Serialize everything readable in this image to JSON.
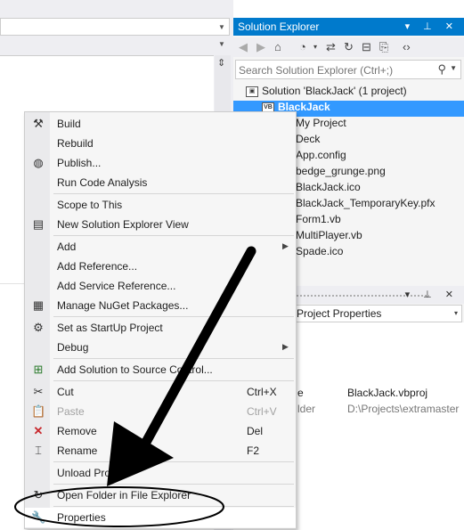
{
  "solution_explorer": {
    "title": "Solution Explorer",
    "title_buttons": "▾ ⊥ ✕",
    "search_placeholder": "Search Solution Explorer (Ctrl+;)",
    "tree": [
      {
        "label": "Solution 'BlackJack' (1 project)",
        "icon": "solution-icon"
      },
      {
        "label": "BlackJack",
        "icon": "vb-project-icon",
        "selected": true
      },
      {
        "label": "My Project",
        "icon": "folder-icon"
      },
      {
        "label": "Deck",
        "icon": "class-icon"
      },
      {
        "label": "App.config",
        "icon": "config-file-icon"
      },
      {
        "label": "bedge_grunge.png",
        "icon": "image-file-icon"
      },
      {
        "label": "BlackJack.ico",
        "icon": "icon-file-icon"
      },
      {
        "label": "BlackJack_TemporaryKey.pfx",
        "icon": "key-file-icon"
      },
      {
        "label": "Form1.vb",
        "icon": "form-icon"
      },
      {
        "label": "MultiPlayer.vb",
        "icon": "vb-file-icon"
      },
      {
        "label": "Spade.ico",
        "icon": "icon-file-icon"
      }
    ]
  },
  "properties": {
    "title_buttons": "▾ ⊥ ✕",
    "combo_label": "Project Properties",
    "rows": [
      {
        "name": "e",
        "value": "BlackJack.vbproj"
      },
      {
        "name": "lder",
        "value": "D:\\Projects\\extramaster"
      }
    ]
  },
  "context_menu": {
    "items": [
      {
        "label": "Build",
        "icon": "build-icon"
      },
      {
        "label": "Rebuild",
        "icon": ""
      },
      {
        "label": "Publish...",
        "icon": "publish-icon"
      },
      {
        "label": "Run Code Analysis",
        "icon": ""
      },
      {
        "label": "Scope to This",
        "icon": ""
      },
      {
        "label": "New Solution Explorer View",
        "icon": "new-view-icon"
      },
      {
        "label": "Add",
        "icon": "",
        "submenu": true
      },
      {
        "label": "Add Reference...",
        "icon": ""
      },
      {
        "label": "Add Service Reference...",
        "icon": ""
      },
      {
        "label": "Manage NuGet Packages...",
        "icon": "nuget-icon"
      },
      {
        "label": "Set as StartUp Project",
        "icon": "gear-icon"
      },
      {
        "label": "Debug",
        "icon": "",
        "submenu": true
      },
      {
        "label": "Add Solution to Source Control...",
        "icon": "source-control-icon"
      },
      {
        "label": "Cut",
        "icon": "scissors-icon",
        "shortcut": "Ctrl+X"
      },
      {
        "label": "Paste",
        "icon": "paste-icon",
        "shortcut": "Ctrl+V",
        "disabled": true
      },
      {
        "label": "Remove",
        "icon": "remove-icon",
        "shortcut": "Del"
      },
      {
        "label": "Rename",
        "icon": "rename-icon",
        "shortcut": "F2"
      },
      {
        "label": "Unload Project",
        "icon": ""
      },
      {
        "label": "Open Folder in File Explorer",
        "icon": "refresh-folder-icon"
      },
      {
        "label": "Properties",
        "icon": "wrench-icon"
      }
    ]
  },
  "colors": {
    "accent": "#007acc",
    "selection": "#3399ff",
    "annotation": "#000000"
  }
}
